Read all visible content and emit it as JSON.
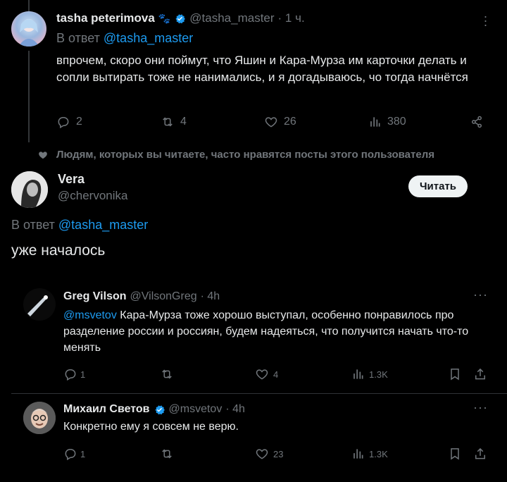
{
  "post1": {
    "name": "tasha peterimova",
    "emoji": "🐾",
    "handle": "@tasha_master",
    "time": "· 1 ч.",
    "reply_prefix": "В ответ",
    "reply_to": "@tasha_master",
    "text": "впрочем, скоро они поймут, что Яшин и Кара-Мурза им карточки делать и сопли вытирать тоже не нанимались, и я догадываюсь, чо тогда начнётся",
    "replies": "2",
    "reposts": "4",
    "likes": "26",
    "views": "380"
  },
  "social_context": "Людям, которых вы читаете, часто нравятся посты этого пользователя",
  "post2": {
    "name": "Vera",
    "handle": "@chervonika",
    "follow_label": "Читать",
    "reply_prefix": "В ответ",
    "reply_to": "@tasha_master",
    "text": "уже началось"
  },
  "reply1": {
    "name": "Greg Vilson",
    "handle": "@VilsonGreg",
    "time": "· 4h",
    "mention": "@msvetov",
    "text": " Кара-Мурза тоже хорошо выступал, особенно понравилось про разделение россии и россиян, будем надеяться, что получится начать что-то менять",
    "replies": "1",
    "reposts": "",
    "likes": "4",
    "views": "1.3K"
  },
  "reply2": {
    "name": "Михаил Светов",
    "handle": "@msvetov",
    "time": "· 4h",
    "text": "Конкретно ему я совсем не верю.",
    "replies": "1",
    "reposts": "",
    "likes": "23",
    "views": "1.3K"
  },
  "colors": {
    "accent": "#1d9bf0",
    "bg": "#000000",
    "muted": "#71767b"
  }
}
